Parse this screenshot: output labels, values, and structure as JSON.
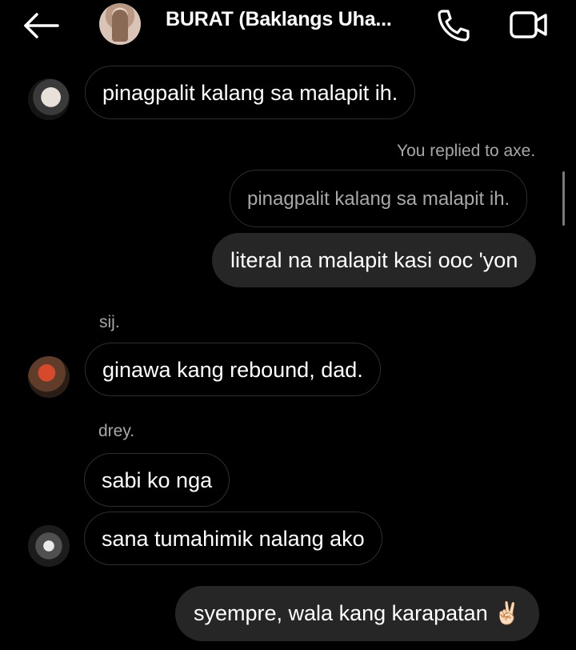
{
  "header": {
    "title": "BURAT (Baklangs Uha...",
    "back_icon": "arrow-left-icon",
    "call_icon": "phone-icon",
    "video_icon": "video-camera-icon"
  },
  "messages": [
    {
      "sender": "axe",
      "text": "pinagpalit kalang sa malapit ih."
    },
    {
      "reply_note": "You replied to axe.",
      "quoted": "pinagpalit kalang sa malapit ih."
    },
    {
      "sender": "me",
      "text": "literal na malapit kasi ooc 'yon"
    },
    {
      "sender_name": "sij.",
      "text": "ginawa kang rebound, dad."
    },
    {
      "sender_name": "drey.",
      "text": "sabi ko nga"
    },
    {
      "text": "sana tumahimik nalang ako"
    },
    {
      "sender": "me",
      "text": "syempre, wala kang karapatan",
      "emoji": "✌🏻"
    }
  ],
  "colors": {
    "background": "#000000",
    "outgoing_bubble": "#262626",
    "incoming_border": "#2e2e2e",
    "secondary_text": "#a8a8a8"
  }
}
